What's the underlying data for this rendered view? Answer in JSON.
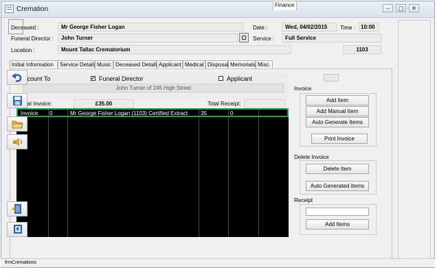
{
  "window": {
    "title": "Cremation",
    "controls": [
      "–",
      "▢",
      "✕"
    ]
  },
  "header": {
    "deceased_label": "Deceased :",
    "deceased_value": "Mr George Fisher Logan",
    "date_label": "Date :",
    "date_value": "Wed, 04/02/2015",
    "time_label": "Time :",
    "time_value": "10:00",
    "funeral_director_label": "Funeral Director :",
    "funeral_director_value": "John Turner",
    "service_label": "Service :",
    "service_value": "Full Service",
    "location_label": "Location :",
    "location_value": "Mount Tallac Crematorium",
    "record_number": "1103"
  },
  "tabs": [
    {
      "label": "Initial Information"
    },
    {
      "label": "Service Details"
    },
    {
      "label": "Music"
    },
    {
      "label": "Deceased Details"
    },
    {
      "label": "Applicant"
    },
    {
      "label": "Medical"
    },
    {
      "label": "Disposal"
    },
    {
      "label": "Memorials"
    },
    {
      "label": "Misc."
    },
    {
      "label": "Finance"
    }
  ],
  "finance": {
    "account_to_label": "Account To",
    "funeral_director_option": "Funeral Director",
    "funeral_director_checked": true,
    "applicant_option": "Applicant",
    "applicant_checked": false,
    "account_address": "John Turner of 245 High Street",
    "total_invoice_label": "Total Invoice:",
    "total_invoice_value": "£35.00",
    "total_receipt_label": "Total Receipt:",
    "total_receipt_value": "",
    "rows": [
      {
        "type": "Invoice",
        "qty": "0",
        "description": "Mr George Fisher Logan (1103) Certified Extract",
        "amount": "35",
        "paid": "0"
      }
    ]
  },
  "invoice_section": {
    "title": "Invoice",
    "add_item": "Add Item",
    "add_manual_item": "Add Manual Item",
    "auto_generate_items": "Auto Generate Items",
    "print_invoice": "Print Invoice"
  },
  "delete_invoice_section": {
    "title": "Delete Invoice",
    "delete_item": "Delete  Item",
    "auto_generated_items": "Auto Generated Items"
  },
  "receipt_section": {
    "title": "Receipt",
    "receipt_input_value": "",
    "add_items": "Add Items"
  },
  "sidebar_icons": [
    "undo-icon",
    "save-icon",
    "folder-icon",
    "speaker-icon",
    "exit-door-icon",
    "export-icon"
  ],
  "status_bar": {
    "text": "frmCremations"
  },
  "colors": {
    "grid_background": "#000000",
    "selected_row_border": "#1aa84a",
    "window_border": "#8fa6c2"
  }
}
